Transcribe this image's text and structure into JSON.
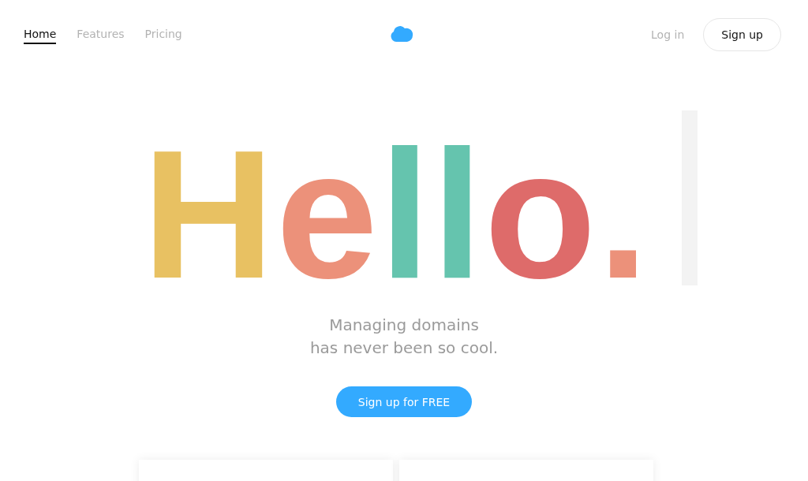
{
  "nav": {
    "links": [
      {
        "label": "Home",
        "selected": true
      },
      {
        "label": "Features",
        "selected": false
      },
      {
        "label": "Pricing",
        "selected": false
      }
    ],
    "login": "Log in",
    "signup": "Sign up"
  },
  "hero": {
    "letters": [
      {
        "char": "H",
        "color": "#e8c162"
      },
      {
        "char": "e",
        "color": "#ec917a"
      },
      {
        "char": "l",
        "color": "#65c4ae"
      },
      {
        "char": "l",
        "color": "#65c4ae"
      },
      {
        "char": "o",
        "color": "#de6b6a"
      },
      {
        "char": ".",
        "color": "#ec917a"
      }
    ],
    "tagline": [
      "Managing domains",
      "has never been so cool."
    ],
    "cta": "Sign up for FREE"
  }
}
